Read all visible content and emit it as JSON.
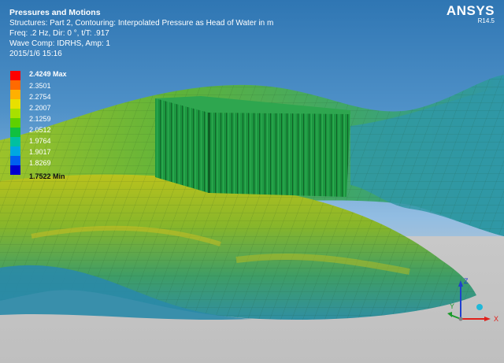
{
  "header": {
    "title": "Pressures and Motions",
    "lines": [
      "Structures: Part 2, Contouring: Interpolated Pressure as Head of Water in m",
      "Freq: .2 Hz, Dir: 0 °, t/T: .917",
      "Wave Comp: IDRHS, Amp: 1",
      "2015/1/6 15:16"
    ]
  },
  "brand": {
    "name": "ANSYS",
    "version": "R14.5"
  },
  "legend": {
    "max_label": "2.4249 Max",
    "min_label": "1.7522 Min",
    "labels": [
      "2.3501",
      "2.2754",
      "2.2007",
      "2.1259",
      "2.0512",
      "1.9764",
      "1.9017",
      "1.8269"
    ],
    "colors": [
      "#ff0000",
      "#ff6a00",
      "#ffb000",
      "#e8e000",
      "#a8e000",
      "#5fd000",
      "#10c040",
      "#00c0a0",
      "#00a8e0",
      "#0060f0",
      "#0000d0"
    ]
  },
  "triad": {
    "x": "X",
    "y": "Y",
    "z": "Z"
  },
  "colors": {
    "sea_green": "#5aa836",
    "sea_yellow": "#b9c21d",
    "sea_blue": "#3aa0c8",
    "structure": "#1f9a45"
  }
}
